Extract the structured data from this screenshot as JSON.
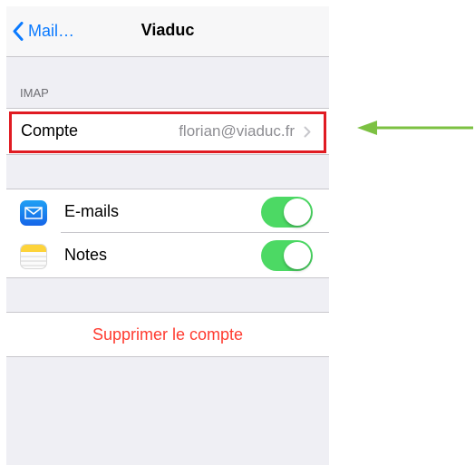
{
  "navbar": {
    "back_label": "Mail…",
    "title": "Viaduc"
  },
  "account_section": {
    "header": "IMAP",
    "row_label": "Compte",
    "row_value": "florian@viaduc.fr"
  },
  "services": [
    {
      "label": "E-mails",
      "enabled": true,
      "icon": "mail-icon"
    },
    {
      "label": "Notes",
      "enabled": true,
      "icon": "notes-icon"
    }
  ],
  "actions": {
    "delete_label": "Supprimer le compte"
  },
  "colors": {
    "ios_blue": "#0a7aff",
    "toggle_green": "#4cd964",
    "delete_red": "#ff3b30",
    "highlight_red": "#e01b22",
    "arrow_green": "#7cc142"
  }
}
